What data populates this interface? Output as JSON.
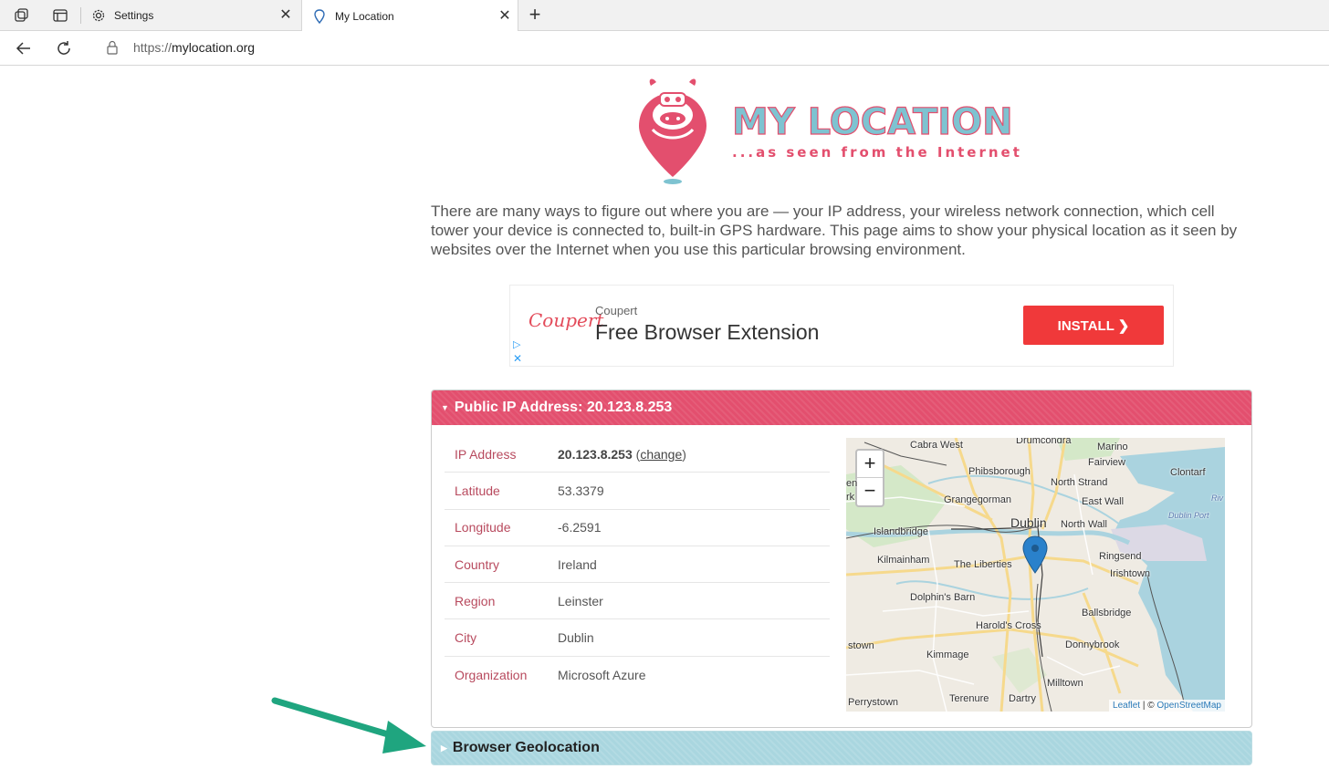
{
  "browser": {
    "tabs": [
      {
        "title": "Settings",
        "icon": "gear-icon"
      },
      {
        "title": "My Location",
        "icon": "location-pin-icon"
      }
    ],
    "close_glyph": "✕",
    "new_tab_glyph": "+",
    "url_protocol": "https://",
    "url_host": "mylocation.org"
  },
  "logo": {
    "title": "MY LOCATION",
    "tagline": "...as seen from the Internet",
    "colors": {
      "pink": "#e34f6e",
      "blue": "#7ec3d1"
    }
  },
  "intro": "There are many ways to figure out where you are — your IP address, your wireless network connection, which cell tower your device is connected to, built-in GPS hardware. This page aims to show your physical location as it seen by websites over the Internet when you use this particular browsing environment.",
  "ad": {
    "logo_text": "Coupert",
    "brand": "Coupert",
    "title": "Free Browser Extension",
    "button": "INSTALL ❯"
  },
  "ip_panel": {
    "header": "Public IP Address: 20.123.8.253",
    "rows": [
      {
        "key": "IP Address",
        "value": "20.123.8.253",
        "link": "change"
      },
      {
        "key": "Latitude",
        "value": "53.3379"
      },
      {
        "key": "Longitude",
        "value": "-6.2591"
      },
      {
        "key": "Country",
        "value": "Ireland"
      },
      {
        "key": "Region",
        "value": "Leinster"
      },
      {
        "key": "City",
        "value": "Dublin"
      },
      {
        "key": "Organization",
        "value": "Microsoft Azure"
      }
    ],
    "map": {
      "zoom_in": "+",
      "zoom_out": "−",
      "labels": {
        "cabra_west": "Cabra West",
        "drumcondra": "Drumcondra",
        "marino": "Marino",
        "fairview": "Fairview",
        "clontarf": "Clontarf",
        "phibsborough": "Phibsborough",
        "north_strand": "North Strand",
        "east_wall": "East Wall",
        "grangegorman": "Grangegorman",
        "dublin": "Dublin",
        "north_wall": "North Wall",
        "dublin_port": "Dublin Port",
        "islandbridge": "Islandbridge",
        "kilmainham": "Kilmainham",
        "the_liberties": "The Liberties",
        "ringsend": "Ringsend",
        "irishtown": "Irishtown",
        "dolphins_barn": "Dolphin's Barn",
        "harolds_cross": "Harold's Cross",
        "ballsbridge": "Ballsbridge",
        "kimmage": "Kimmage",
        "donnybrook": "Donnybrook",
        "milltown": "Milltown",
        "perrystown": "Perrystown",
        "terenure": "Terenure",
        "dartry": "Dartry",
        "stown": "stown",
        "riv": "Riv",
        "en": "en",
        "rk": "rk"
      },
      "attribution_leaflet": "Leaflet",
      "attribution_sep": " | © ",
      "attribution_osm": "OpenStreetMap"
    }
  },
  "geo_panel": {
    "header": "Browser Geolocation"
  }
}
